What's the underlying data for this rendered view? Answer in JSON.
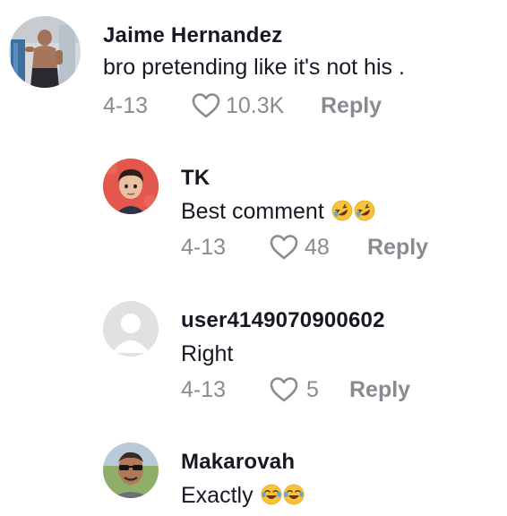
{
  "comments": [
    {
      "username": "Jaime Hernandez",
      "text": "bro pretending like it's not his .",
      "date": "4-13",
      "likes": "10.3K",
      "reply_label": "Reply",
      "avatar_icon": "gym-selfie-avatar"
    },
    {
      "username": "TK",
      "text": "Best comment",
      "emoji": [
        "rolling-on-floor-laughing",
        "rolling-on-floor-laughing"
      ],
      "date": "4-13",
      "likes": "48",
      "reply_label": "Reply",
      "avatar_icon": "cartoon-avatar"
    },
    {
      "username": "user4149070900602",
      "text": "Right",
      "date": "4-13",
      "likes": "5",
      "reply_label": "Reply",
      "avatar_icon": "default-user-avatar"
    },
    {
      "username": "Makarovah",
      "text": "Exactly",
      "emoji": [
        "face-with-tears-of-joy",
        "face-with-tears-of-joy"
      ],
      "avatar_icon": "sunglasses-avatar"
    }
  ],
  "colors": {
    "text": "#161823",
    "muted": "#8a8b91"
  }
}
